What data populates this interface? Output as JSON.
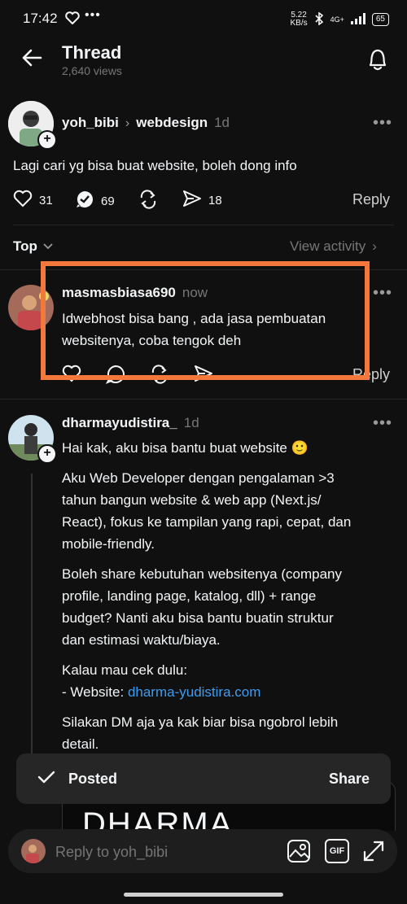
{
  "status_bar": {
    "time": "17:42",
    "net_speed": "5.22",
    "net_unit": "KB/s",
    "battery": "65",
    "signal": "4G+"
  },
  "header": {
    "title": "Thread",
    "views": "2,640 views"
  },
  "main_post": {
    "username": "yoh_bibi",
    "community": "webdesign",
    "time": "1d",
    "text": "Lagi cari yg bisa buat website, boleh dong info",
    "likes": "31",
    "comments": "69",
    "shares": "18",
    "reply_label": "Reply"
  },
  "sort": {
    "label": "Top",
    "view_activity": "View activity"
  },
  "reply1": {
    "username": "masmasbiasa690",
    "time": "now",
    "text_line1": "Idwebhost bisa bang , ada jasa pembuatan",
    "text_line2": "websitenya, coba tengok deh",
    "reply_label": "Reply"
  },
  "reply2": {
    "username": "dharmayudistira_",
    "time": "1d",
    "p1": "Hai kak, aku bisa bantu buat website 🙂",
    "p2_l1": "Aku Web Developer dengan pengalaman >3",
    "p2_l2": "tahun bangun website & web app (Next.js/",
    "p2_l3": "React), fokus ke tampilan yang rapi, cepat, dan",
    "p2_l4": "mobile-friendly.",
    "p3_l1": "Boleh share kebutuhan websitenya (company",
    "p3_l2": "profile, landing page, katalog, dll) + range",
    "p3_l3": "budget? Nanti aku bisa bantu buatin struktur",
    "p3_l4": "dan estimasi waktu/biaya.",
    "p4_l1": "Kalau mau cek dulu:",
    "p4_prefix": "- Website: ",
    "p4_link": "dharma-yudistira.com",
    "p5_l1": "Silakan DM aja ya kak biar bisa ngobrol lebih",
    "p5_l2": "detail.",
    "preview_text": "DHARMA"
  },
  "toast": {
    "label": "Posted",
    "action": "Share"
  },
  "reply_bar": {
    "placeholder": "Reply to yoh_bibi",
    "gif_label": "GIF"
  },
  "colors": {
    "background": "#101010",
    "text": "#f3f5f7",
    "muted": "#777777",
    "link": "#3c9df0",
    "highlight": "#f4783c"
  }
}
